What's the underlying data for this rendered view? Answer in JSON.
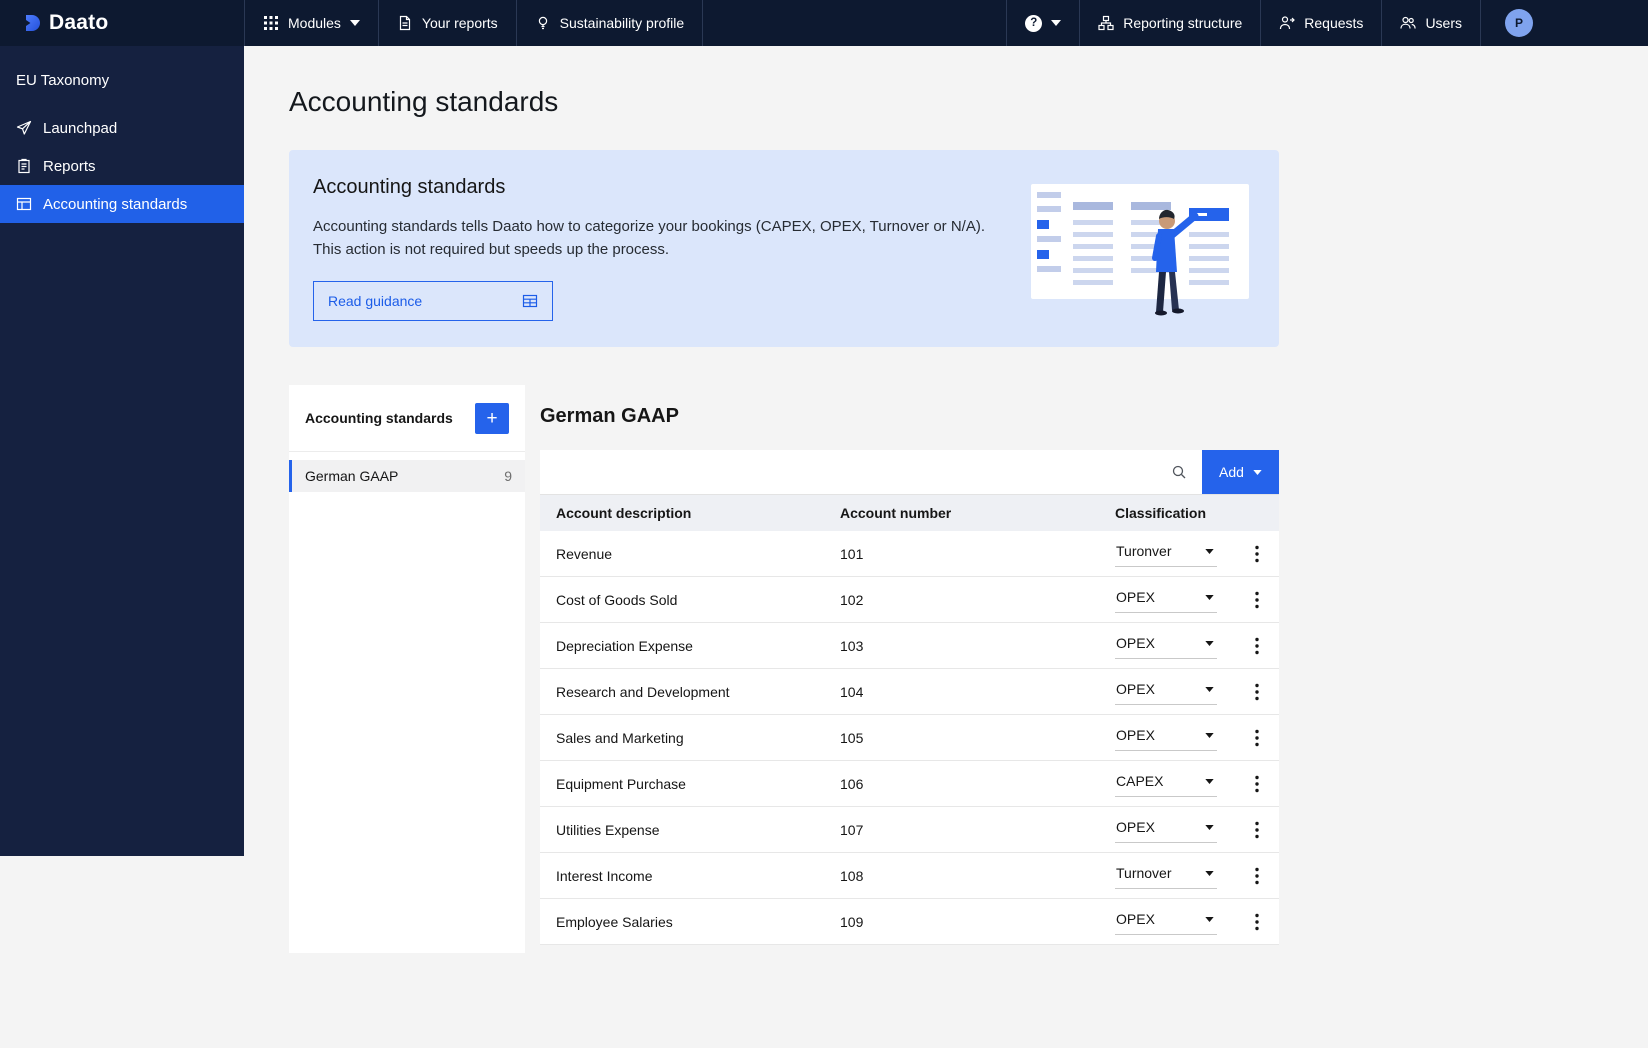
{
  "brand": {
    "name": "Daato",
    "icon": "daato-logo-icon"
  },
  "topbar": {
    "modules": {
      "label": "Modules",
      "icon": "grid-icon"
    },
    "your_reports": {
      "label": "Your reports",
      "icon": "report-icon"
    },
    "sustainability": {
      "label": "Sustainability profile",
      "icon": "bulb-icon"
    },
    "help": {
      "symbol": "?",
      "icon": "help-icon"
    },
    "reporting_structure": {
      "label": "Reporting structure",
      "icon": "tree-icon"
    },
    "requests": {
      "label": "Requests",
      "icon": "request-icon"
    },
    "users": {
      "label": "Users",
      "icon": "users-icon"
    },
    "avatar": {
      "initial": "P"
    }
  },
  "sidebar": {
    "section_title": "EU Taxonomy",
    "items": [
      {
        "label": "Launchpad",
        "icon": "send-icon",
        "active": false
      },
      {
        "label": "Reports",
        "icon": "clipboard-icon",
        "active": false
      },
      {
        "label": "Accounting standards",
        "icon": "table-doc-icon",
        "active": true
      }
    ]
  },
  "page": {
    "title": "Accounting standards",
    "banner": {
      "title": "Accounting standards",
      "body_line1": "Accounting standards tells Daato how to categorize your bookings (CAPEX, OPEX, Turnover or N/A).",
      "body_line2": "This action is not required but speeds up the process.",
      "button_label": "Read guidance",
      "button_icon": "guidance-table-icon"
    },
    "standards_panel": {
      "header": "Accounting standards",
      "add_label": "+",
      "items": [
        {
          "label": "German GAAP",
          "count": "9",
          "active": true
        }
      ]
    },
    "detail": {
      "title": "German GAAP",
      "search_placeholder": "",
      "add_button": "Add",
      "table": {
        "columns": [
          "Account description",
          "Account number",
          "Classification"
        ],
        "rows": [
          {
            "description": "Revenue",
            "number": "101",
            "classification": "Turonver"
          },
          {
            "description": "Cost of Goods Sold",
            "number": "102",
            "classification": "OPEX"
          },
          {
            "description": "Depreciation Expense",
            "number": "103",
            "classification": "OPEX"
          },
          {
            "description": "Research and Development",
            "number": "104",
            "classification": "OPEX"
          },
          {
            "description": "Sales and Marketing",
            "number": "105",
            "classification": "OPEX"
          },
          {
            "description": "Equipment Purchase",
            "number": "106",
            "classification": "CAPEX"
          },
          {
            "description": "Utilities Expense",
            "number": "107",
            "classification": "OPEX"
          },
          {
            "description": "Interest Income",
            "number": "108",
            "classification": "Turnover"
          },
          {
            "description": "Employee Salaries",
            "number": "109",
            "classification": "OPEX"
          }
        ]
      }
    }
  },
  "colors": {
    "accent": "#2563eb",
    "topbar_bg": "#0d1930",
    "sidebar_bg": "#152140",
    "banner_bg": "#dbe6fb",
    "page_bg": "#f4f4f4"
  }
}
